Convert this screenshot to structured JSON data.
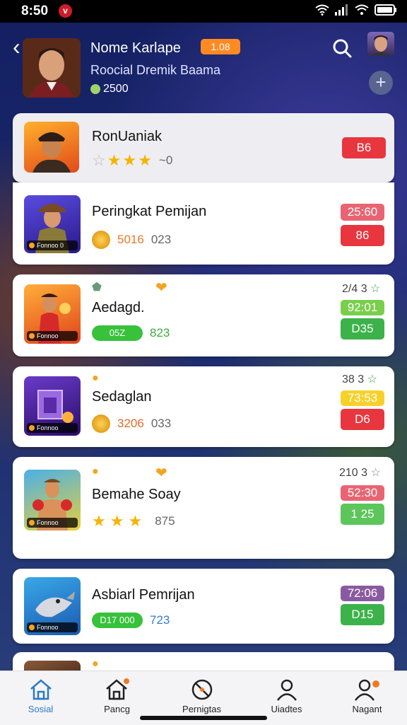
{
  "status": {
    "time": "8:50",
    "notification": "v"
  },
  "header": {
    "title": "Nome Karlape",
    "badge": "1.08",
    "subtitle": "Roocial Dremik Baama",
    "points": "2500"
  },
  "cards": [
    {
      "name": "RonUaniak",
      "badge": "B6",
      "stars": 4,
      "extra": "~0"
    },
    {
      "name": "Peringkat Pemijan",
      "thumb_tag": "Fonnoo 0",
      "score": "5016",
      "count": "023",
      "top_badge": "25:60",
      "bottom_badge": "86"
    },
    {
      "name": "Aedagd.",
      "thumb_tag": "Fonnoo",
      "bar": "05Z",
      "count": "823",
      "corner": "2/4 3",
      "top_badge": "92:01",
      "bottom_badge": "D35"
    },
    {
      "name": "Sedaglan",
      "thumb_tag": "Fonnoo",
      "score": "3206",
      "count": "033",
      "corner": "38 3",
      "top_badge": "73:53",
      "bottom_badge": "D6"
    },
    {
      "name": "Bemahe Soay",
      "thumb_tag": "Fonnoo",
      "count": "875",
      "corner": "210 3",
      "top_badge": "52:30",
      "bottom_badge": "1 25"
    },
    {
      "name": "Asbiarl Pemrijan",
      "thumb_tag": "Fonnoo",
      "bar": "D17 000",
      "count": "723",
      "top_badge": "72:06",
      "bottom_badge": "D15"
    }
  ],
  "nav": [
    {
      "label": "Sosial",
      "icon": "home-icon"
    },
    {
      "label": "Pancg",
      "icon": "home-icon"
    },
    {
      "label": "Pernigtas",
      "icon": "no-icon"
    },
    {
      "label": "Uiadtes",
      "icon": "person-icon"
    },
    {
      "label": "Nagant",
      "icon": "person-plus-icon"
    }
  ]
}
